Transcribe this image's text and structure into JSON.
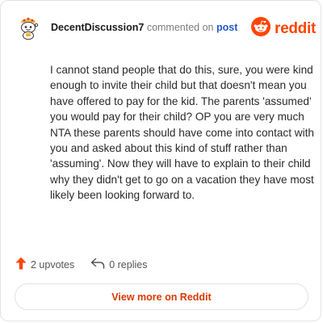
{
  "comment": {
    "username": "DecentDiscussion7",
    "action_text": "commented on",
    "post_link": "post",
    "body": "I cannot stand people that do this, sure, you were kind enough to invite their child but that doesn't mean you have offered to pay for the kid. The parents 'assumed' you would pay for their child? OP you are very much NTA these parents should have come into contact with you and asked about this kind of stuff rather than 'assuming'. Now they will have to explain to their child why they didn't get to go on a vacation they have most likely been looking forward to."
  },
  "brand": {
    "icon": "reddit-snoo-icon",
    "name": "reddit",
    "color": "#ff4500"
  },
  "stats": {
    "upvotes": "2 upvotes",
    "upvote_icon": "upvote-arrow-icon",
    "replies": "0 replies",
    "reply_icon": "reply-arrow-icon"
  },
  "footer": {
    "view_button": "View more on Reddit"
  },
  "colors": {
    "accent": "#ff4500",
    "link": "#2358c5",
    "button_text": "#d93900"
  }
}
